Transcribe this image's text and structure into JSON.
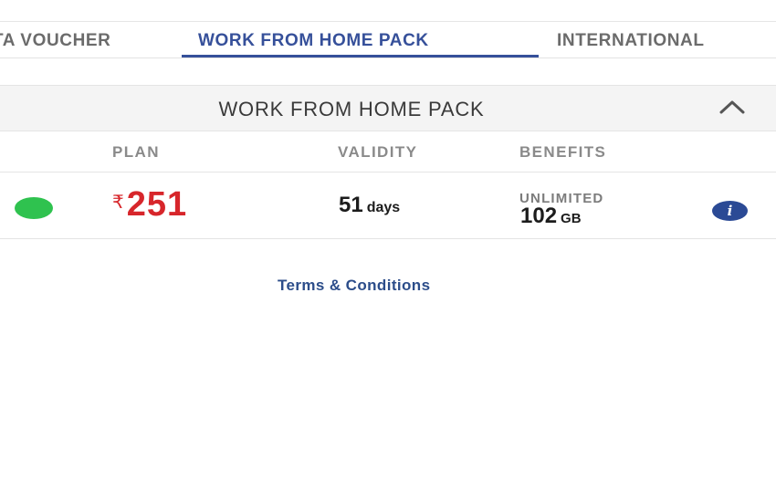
{
  "tabs": {
    "items": [
      {
        "label": "TA VOUCHER",
        "active": false
      },
      {
        "label": "WORK FROM HOME PACK",
        "active": true
      },
      {
        "label": "INTERNATIONAL",
        "active": false
      }
    ]
  },
  "section": {
    "title": "WORK FROM HOME PACK",
    "expanded": true,
    "toggle_icon": "chevron-up-icon"
  },
  "columns": {
    "plan": "PLAN",
    "validity": "VALIDITY",
    "benefits": "BENEFITS"
  },
  "plan_row": {
    "status_color": "#2fc24f",
    "currency_symbol": "₹",
    "price": "251",
    "validity_value": "51",
    "validity_unit": "days",
    "benefit_label": "UNLIMITED",
    "benefit_value": "102",
    "benefit_unit": "GB",
    "info_icon": "i"
  },
  "footer": {
    "terms_label": "Terms & Conditions"
  },
  "colors": {
    "accent": "#36509a",
    "price": "#d7262b",
    "status": "#2fc24f",
    "link": "#2c4d8a"
  }
}
